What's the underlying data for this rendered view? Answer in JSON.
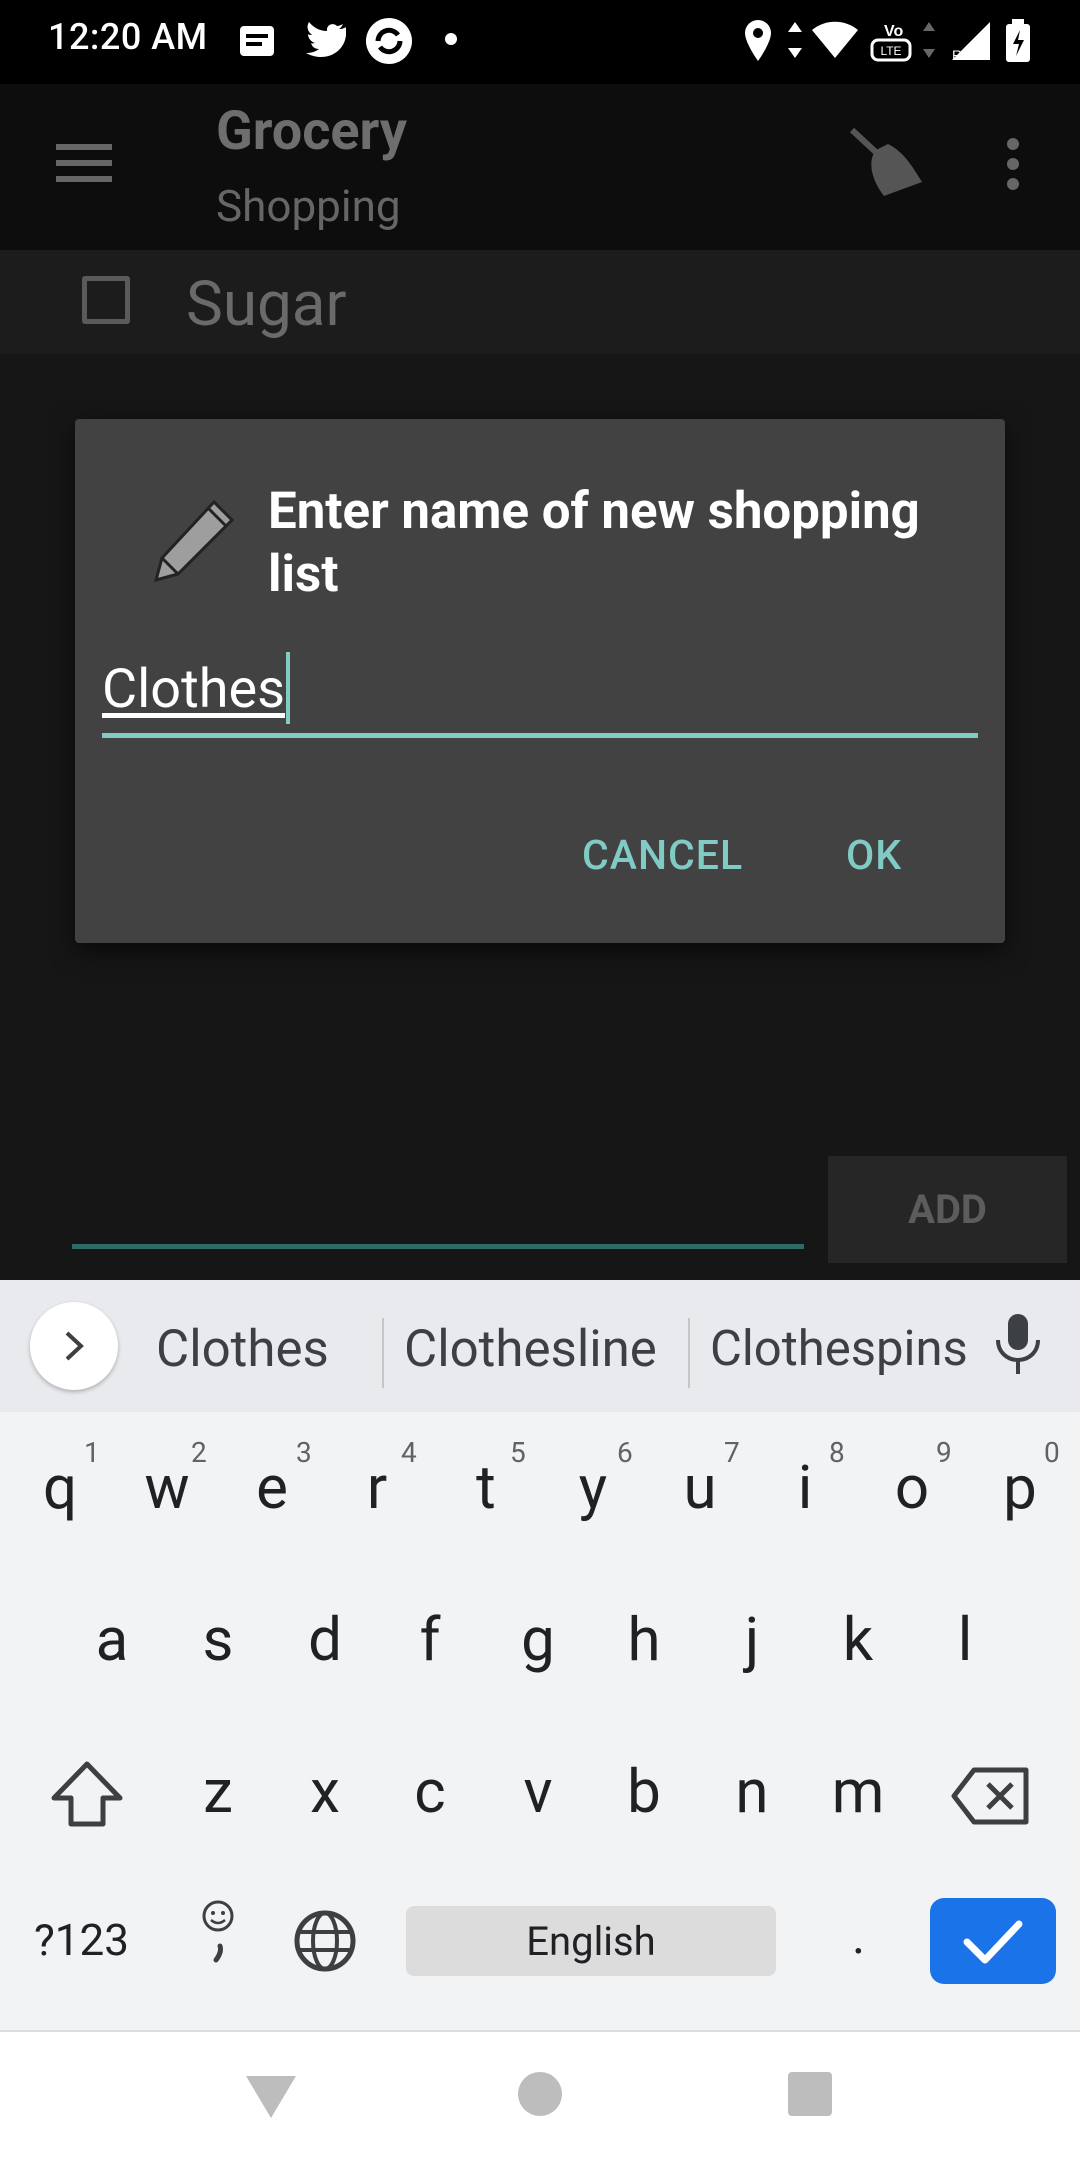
{
  "status_bar": {
    "time": "12:20 AM"
  },
  "toolbar": {
    "title": "Grocery",
    "subtitle": "Shopping"
  },
  "list": {
    "items": [
      {
        "label": "Sugar",
        "checked": false
      }
    ]
  },
  "dialog": {
    "title": "Enter name of new shopping list",
    "input_value": "Clothes",
    "cancel_label": "CANCEL",
    "ok_label": "OK"
  },
  "add_bar": {
    "button_label": "ADD"
  },
  "keyboard": {
    "suggestions": [
      "Clothes",
      "Clothesline",
      "Clothespins"
    ],
    "row1": [
      "q",
      "w",
      "e",
      "r",
      "t",
      "y",
      "u",
      "i",
      "o",
      "p"
    ],
    "row1_hints": [
      "1",
      "2",
      "3",
      "4",
      "5",
      "6",
      "7",
      "8",
      "9",
      "0"
    ],
    "row2": [
      "a",
      "s",
      "d",
      "f",
      "g",
      "h",
      "j",
      "k",
      "l"
    ],
    "row3": [
      "z",
      "x",
      "c",
      "v",
      "b",
      "n",
      "m"
    ],
    "symbols_label": "?123",
    "space_label": "English",
    "period_label": "."
  },
  "colors": {
    "accent": "#80cbc4",
    "enter_key": "#1a73e8",
    "dialog_bg": "#424242"
  }
}
